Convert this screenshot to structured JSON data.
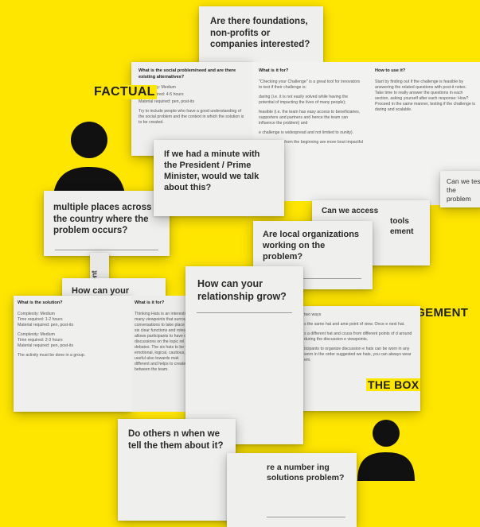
{
  "colors": {
    "background": "#FFE600",
    "card": "#efefed",
    "text": "#2a2a2a"
  },
  "labels": {
    "factual": "FACTUAL",
    "management": "MANAGEMENT",
    "the_box": "THE BOX"
  },
  "questions": {
    "foundations": "Are there foundations, non-profits or companies interested?",
    "minute": "If we had a minute with the President / Prime Minister, would we talk about this?",
    "multiple": "multiple places across the country where the problem occurs?",
    "can_we_access": "Can we access",
    "tools": "tools",
    "ement": "ement",
    "local_orgs": "Are local organizations working on the problem?",
    "relationship": "How can your relationship grow?",
    "how_can_your": "How can your",
    "others": "Do others n when we tell the them about it?",
    "number": "re a number ing solutions problem?",
    "can_we_tes": "Can we tes the problem",
    "vertical": "the erent rame"
  },
  "sheet_social": {
    "title": "What is the social problem/need and are there existing alternatives?",
    "lines": [
      "Complexity: Medium",
      "Time required: 4-5 hours",
      "Material required: pen, post-its"
    ],
    "note": "Try to include people who have a good understanding of the social problem and the context in which the solution is to be created."
  },
  "sheet_whatfor": {
    "title": "What is it for?",
    "p1": "\"Checking your Challenge\" is a great tool for innovators to test if their challenge is:",
    "p2": "daring (i.e. it is not easily solved while having the potential of impacting the lives of many people);",
    "p3": "feasible (i.e. the team has easy access to beneficiaries, supporters and partners and hence the team can influence the problem) and",
    "p4": "e challenge is widespread and not limited to ounity).",
    "p5": "e framed well from the beginning are more bout impactful solutions."
  },
  "sheet_howto": {
    "title": "How to use it?",
    "p1": "Start by finding out if the challenge is feasible by answering the related questions with post-it notes. Take time to really answer the questions in each section, asking yourself after each response: How? Proceed in the same manner, testing if the challenge is daring and scalable."
  },
  "sheet_solution": {
    "title": "What is the solution?",
    "lines1": [
      "Complexity: Medium",
      "Time required: 1-2 hours",
      "Material required: pen, post-its"
    ],
    "lines2": [
      "Complexity: Medium",
      "Time required: 2-3 hours",
      "Material required: pen, post-its"
    ],
    "note": "The activity must be done in a group."
  },
  "sheet_hats": {
    "title": "What is it for?",
    "p1": "Thinking Hats is an interesting many viewpoints that surround conversations to take place w six clear functions and roles. allows participants to have d discussions on the topic rel debates. The six hats to be w emotional, logical, cautious, are useful also towards mak different and helps to create between the team."
  },
  "sheet_hats2": {
    "p1": "two ways",
    "p2": "s the same hat and ame point of view. Once e next hat.",
    "p3": "s a different hat and ccuss from different points of d around during the discussion e viewpoints.",
    "p4": "ticipants to organize discussion e hats can be worn in any worn in the order suggested we hats, you can always wear em."
  }
}
